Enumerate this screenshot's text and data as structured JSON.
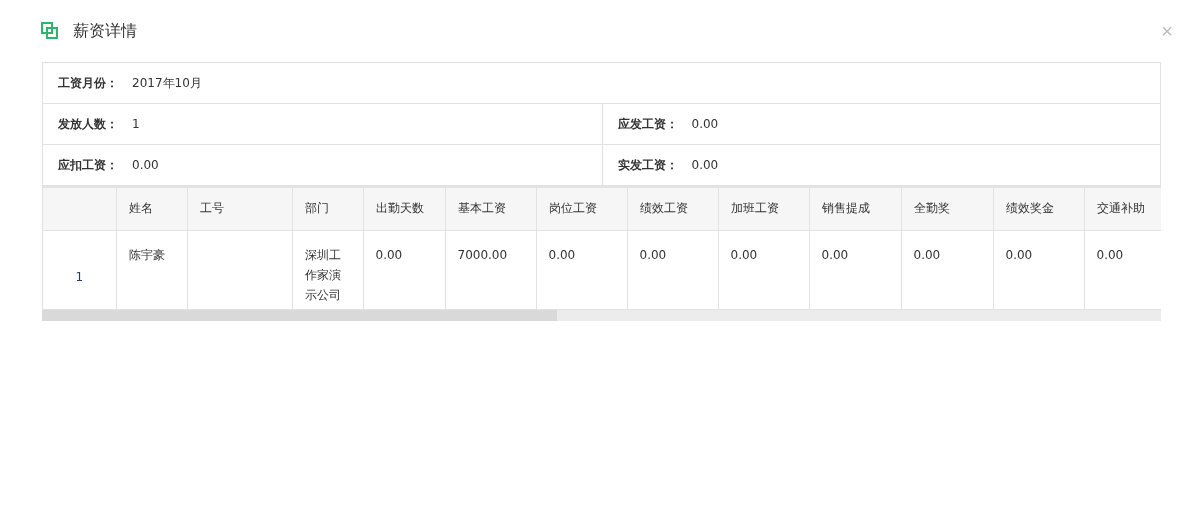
{
  "dialog": {
    "title": "薪资详情",
    "close": "×"
  },
  "summary": [
    [
      {
        "label": "工资月份：",
        "value": "2017年10月"
      }
    ],
    [
      {
        "label": "发放人数：",
        "value": "1"
      },
      {
        "label": "应发工资：",
        "value": "0.00"
      }
    ],
    [
      {
        "label": "应扣工资：",
        "value": "0.00"
      },
      {
        "label": "实发工资：",
        "value": "0.00"
      }
    ]
  ],
  "table": {
    "columns": [
      "",
      "姓名",
      "工号",
      "部门",
      "出勤天数",
      "基本工资",
      "岗位工资",
      "绩效工资",
      "加班工资",
      "销售提成",
      "全勤奖",
      "绩效奖金",
      "交通补助"
    ],
    "rows": [
      [
        "1",
        "陈宇豪",
        "",
        "深圳工作家演示公司",
        "0.00",
        "7000.00",
        "0.00",
        "0.00",
        "0.00",
        "0.00",
        "0.00",
        "0.00",
        "0.00"
      ]
    ]
  }
}
